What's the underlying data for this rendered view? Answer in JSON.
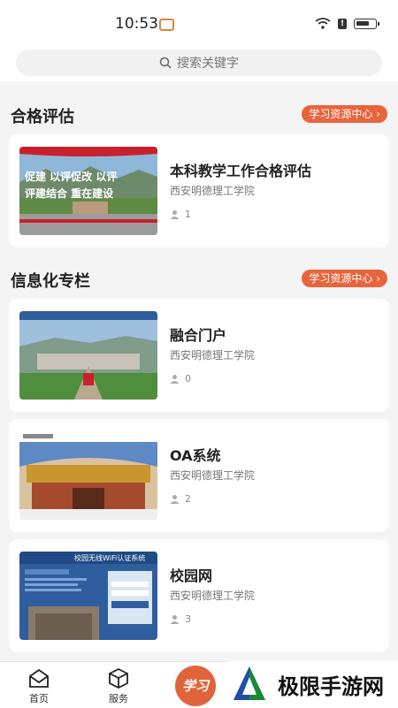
{
  "status_bar": {
    "time": "10:53"
  },
  "search": {
    "placeholder": "搜索关键字"
  },
  "sections": [
    {
      "title": "合格评估",
      "link_label": "学习资源中心 ›"
    },
    {
      "title": "信息化专栏",
      "link_label": "学习资源中心 ›"
    }
  ],
  "cards": [
    {
      "title": "本科教学工作合格评估",
      "subtitle": "西安明德理工学院",
      "views": "1",
      "thumb_line1": "促建 以评促改 以评",
      "thumb_line2": "评建结合 重在建设"
    },
    {
      "title": "融合门户",
      "subtitle": "西安明德理工学院",
      "views": "0"
    },
    {
      "title": "OA系统",
      "subtitle": "西安明德理工学院",
      "views": "2"
    },
    {
      "title": "校园网",
      "subtitle": "西安明德理工学院",
      "views": "3",
      "thumb_header": "校园无线WiFi认证系统"
    }
  ],
  "tabs": [
    {
      "label": "首页",
      "icon": "home-icon"
    },
    {
      "label": "服务",
      "icon": "box-icon"
    },
    {
      "label": "学习",
      "icon": "study-icon"
    }
  ],
  "watermark": {
    "text": "极限手游网"
  },
  "colors": {
    "accent": "#e8643c",
    "background": "#f4f4f4"
  }
}
